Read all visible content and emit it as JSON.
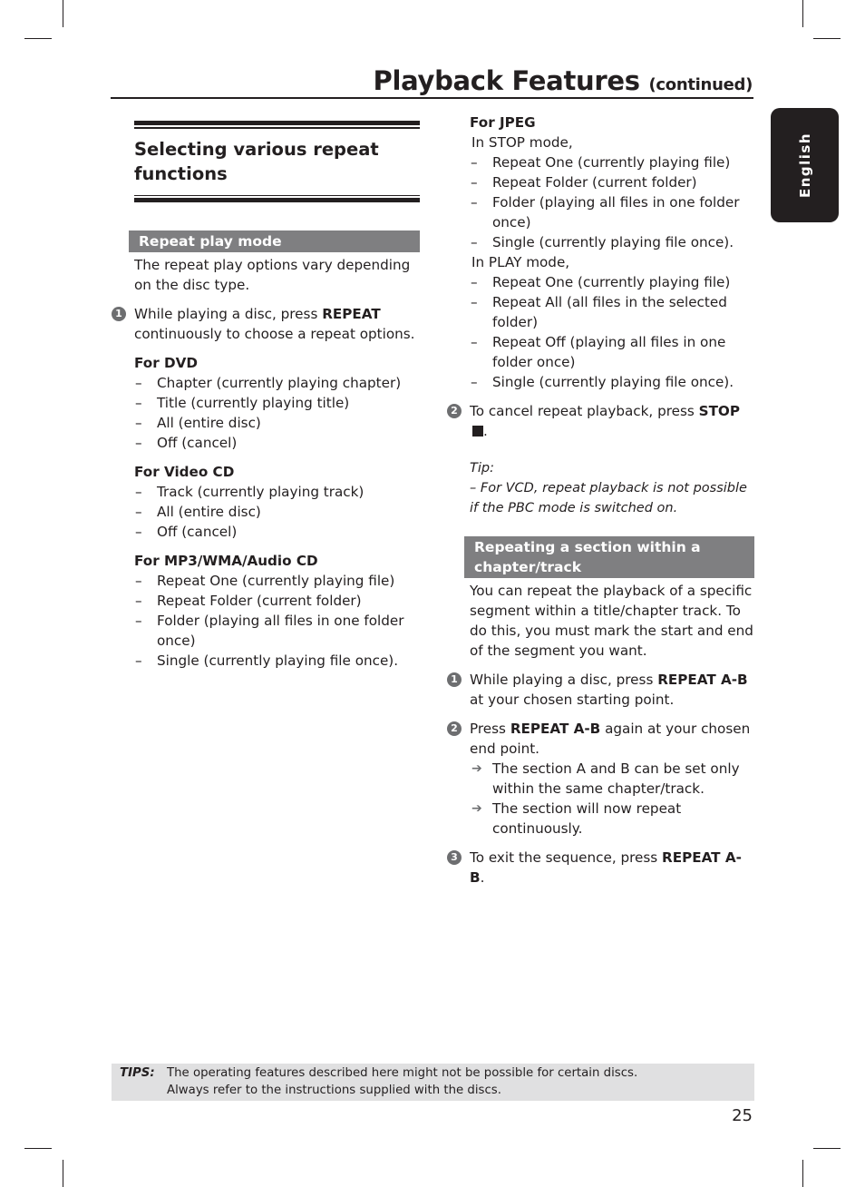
{
  "header": {
    "title": "Playback Features",
    "title_suffix": "(continued)",
    "language_tab": "English"
  },
  "left_column": {
    "section_title_line1": "Selecting various repeat",
    "section_title_line2": "functions",
    "band_title": "Repeat play mode",
    "intro": "The repeat play options vary depending on the disc type.",
    "step1": {
      "number": "1",
      "text_before": "While playing a disc, press ",
      "bold": "REPEAT",
      "text_after": " continuously to choose a repeat options."
    },
    "groups": [
      {
        "heading": "For DVD",
        "items": [
          "Chapter (currently playing chapter)",
          "Title (currently playing title)",
          "All (entire disc)",
          "Off (cancel)"
        ]
      },
      {
        "heading": "For Video CD",
        "items": [
          "Track (currently playing track)",
          "All (entire disc)",
          "Off (cancel)"
        ]
      },
      {
        "heading": "For MP3/WMA/Audio CD",
        "items": [
          "Repeat One (currently playing file)",
          "Repeat Folder (current folder)",
          "Folder (playing all files in one folder once)",
          "Single (currently playing file once)."
        ]
      }
    ]
  },
  "right_column": {
    "jpeg_heading": "For JPEG",
    "stop_mode_label": "In STOP mode,",
    "stop_mode_items": [
      "Repeat One (currently playing file)",
      "Repeat Folder (current folder)",
      "Folder (playing all files in one folder once)",
      "Single (currently playing file once)."
    ],
    "play_mode_label": "In PLAY mode,",
    "play_mode_items": [
      "Repeat One (currently playing file)",
      "Repeat All (all files in the selected folder)",
      "Repeat Off (playing all files in one folder once)",
      "Single (currently playing file once)."
    ],
    "step2": {
      "number": "2",
      "text_before": "To cancel repeat playback, press ",
      "bold": "STOP",
      "text_after": "."
    },
    "tip_label": "Tip:",
    "tip_text": "– For VCD, repeat playback is not possible if the PBC mode is switched on.",
    "band_title": "Repeating a section within a chapter/track",
    "intro": "You can repeat the playback of a specific segment within a title/chapter track. To do this, you must mark the start and end of the segment you want.",
    "ab_steps": [
      {
        "number": "1",
        "text_before": "While playing a disc, press ",
        "bold": "REPEAT A-B",
        "text_after": " at your chosen starting point."
      },
      {
        "number": "2",
        "text_before": "Press ",
        "bold": "REPEAT A-B",
        "text_after": " again at your chosen end point.",
        "results": [
          "The section A and B can be set only within the same chapter/track.",
          "The section will now repeat continuously."
        ]
      },
      {
        "number": "3",
        "text_before": "To exit the sequence, press ",
        "bold": "REPEAT A-B",
        "text_after": "."
      }
    ]
  },
  "footer": {
    "tips_label": "TIPS:",
    "tips_line1": "The operating features described here might not be possible for certain discs.",
    "tips_line2": "Always refer to the instructions supplied with the discs.",
    "page_number": "25"
  }
}
